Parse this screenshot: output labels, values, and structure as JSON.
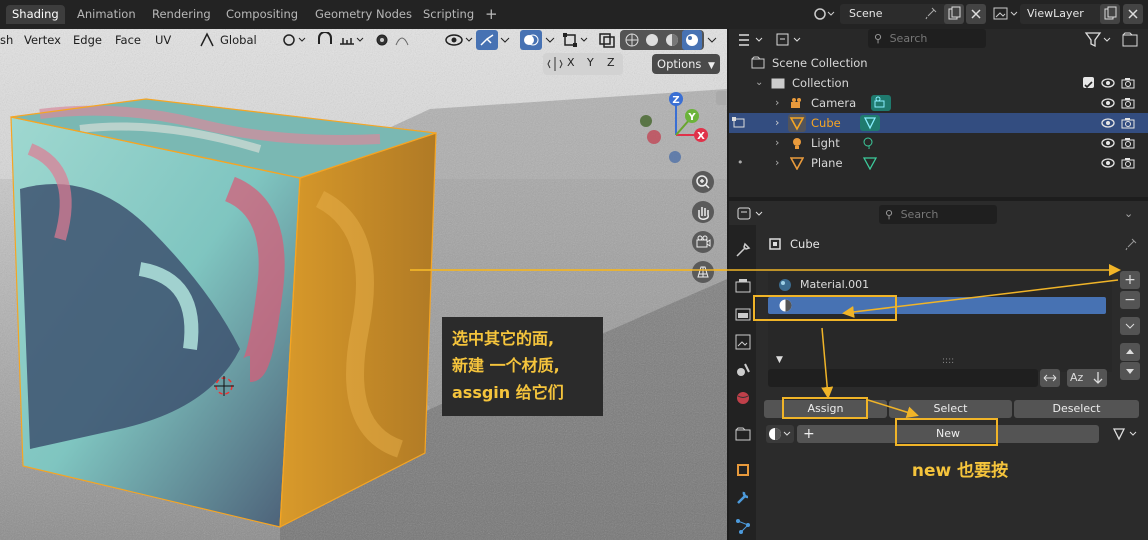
{
  "workspaces": [
    "Shading",
    "Animation",
    "Rendering",
    "Compositing",
    "Geometry Nodes",
    "Scripting"
  ],
  "active_workspace": "Shading",
  "scene": {
    "name": "Scene",
    "view_layer": "ViewLayer"
  },
  "viewport_menu": [
    "sh",
    "Vertex",
    "Edge",
    "Face",
    "UV"
  ],
  "transform_orientation": "Global",
  "axis_labels": [
    "X",
    "Y",
    "Z"
  ],
  "options_label": "Options",
  "gizmo_axes": {
    "x": "X",
    "y": "Y",
    "z": "Z"
  },
  "annotation_viewport": [
    "选中其它的面,",
    "新建 一个材质,",
    "assgin 给它们"
  ],
  "annotation_new": "new 也要按",
  "outliner": {
    "search_placeholder": "Search",
    "scene_collection": "Scene Collection",
    "collection": "Collection",
    "objects": [
      {
        "name": "Camera",
        "type": "camera",
        "selected": false
      },
      {
        "name": "Cube",
        "type": "mesh",
        "selected": true
      },
      {
        "name": "Light",
        "type": "light",
        "selected": false
      },
      {
        "name": "Plane",
        "type": "mesh",
        "selected": false
      }
    ]
  },
  "properties": {
    "search_placeholder": "Search",
    "object_name": "Cube",
    "material_slots": [
      "Material.001",
      ""
    ],
    "buttons": {
      "assign": "Assign",
      "select": "Select",
      "deselect": "Deselect",
      "new": "New"
    },
    "sort_label": "Az"
  },
  "colors": {
    "accent": "#4772b3",
    "highlight": "#f0b428",
    "selected_text": "#f5a524",
    "active_tab": "#3d3d3d"
  }
}
